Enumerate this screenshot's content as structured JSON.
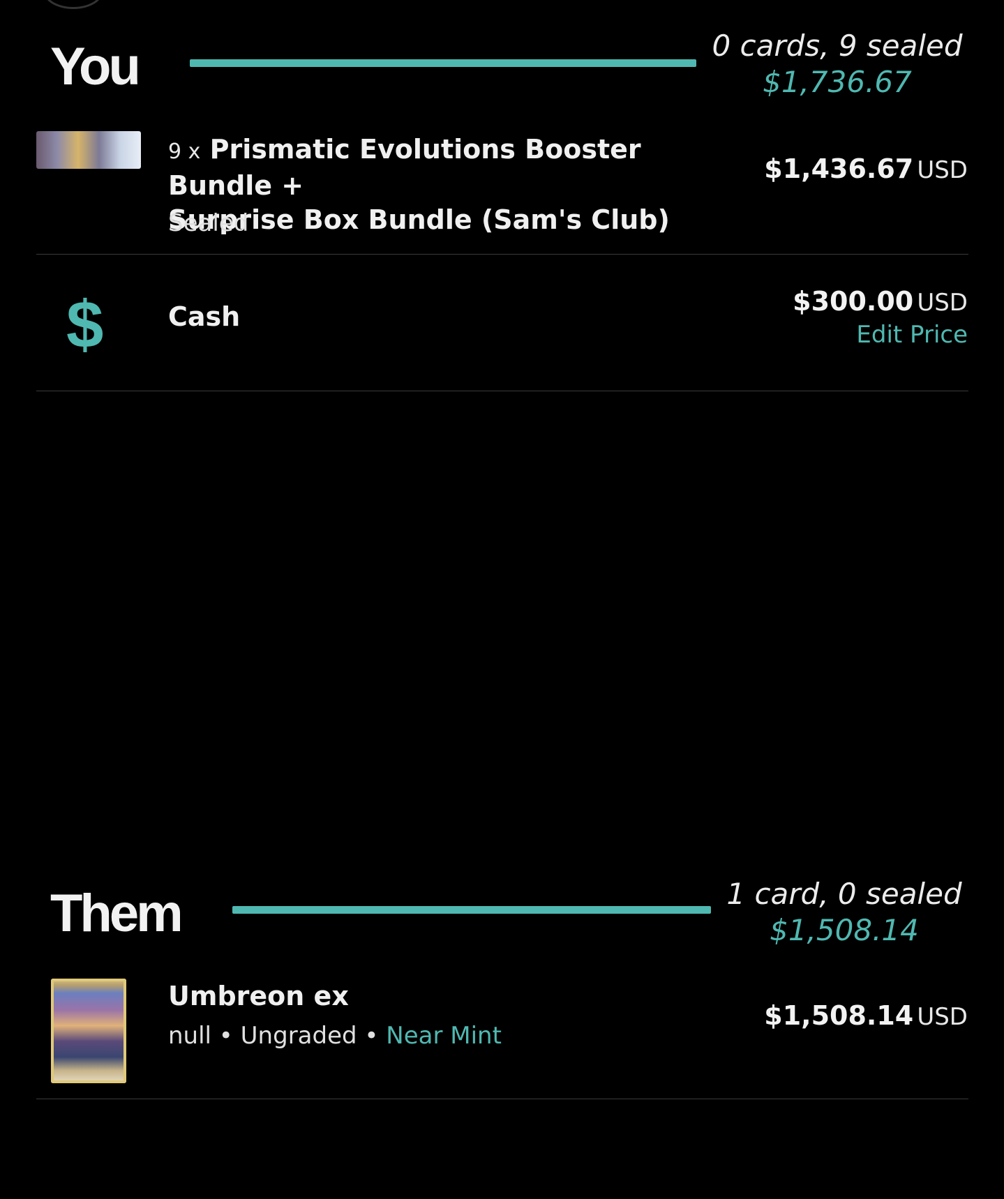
{
  "you": {
    "title": "You",
    "summary": "0 cards, 9 sealed",
    "total": "$1,736.67",
    "items": [
      {
        "quantity": "9 x",
        "name_line1": "Prismatic Evolutions Booster Bundle +",
        "name_line2": "Surprise Box Bundle (Sam's Club)",
        "subtitle": "Sealed",
        "price": "$1,436.67",
        "currency": "USD",
        "thumbnail": "booster-bundle-image"
      }
    ],
    "cash": {
      "icon": "dollar-icon",
      "label": "Cash",
      "price": "$300.00",
      "currency": "USD",
      "edit_label": "Edit Price"
    }
  },
  "them": {
    "title": "Them",
    "summary": "1 card, 0 sealed",
    "total": "$1,508.14",
    "items": [
      {
        "name": "Umbreon ex",
        "set": "null",
        "sep1": " • ",
        "grade": "Ungraded",
        "sep2": " • ",
        "condition": "Near Mint",
        "price": "$1,508.14",
        "currency": "USD",
        "thumbnail": "umbreon-card-image"
      }
    ]
  },
  "colors": {
    "accent": "#4fb8b1",
    "background": "#000000",
    "divider": "#3a3a3a"
  }
}
